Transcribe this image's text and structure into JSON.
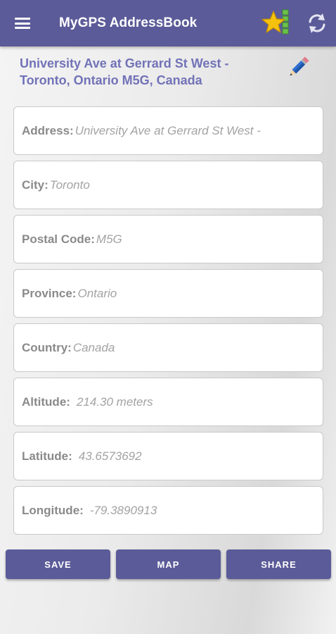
{
  "app_bar": {
    "title": "MyGPS AddressBook",
    "menu_icon": "hamburger-menu-icon",
    "favorites_icon": "star-list-icon",
    "refresh_icon": "refresh-icon",
    "background_color": "#5b5b99"
  },
  "header": {
    "address_title": "University Ave at Gerrard St West - Toronto, Ontario M5G, Canada",
    "edit_icon": "pencil-icon",
    "title_color": "#7272b8"
  },
  "fields": [
    {
      "label": "Address:",
      "value": "University Ave at Gerrard St West -"
    },
    {
      "label": "City:",
      "value": "Toronto"
    },
    {
      "label": "Postal Code:",
      "value": "M5G"
    },
    {
      "label": "Province:",
      "value": "Ontario"
    },
    {
      "label": "Country:",
      "value": "Canada"
    },
    {
      "label": "Altitude:",
      "value": "214.30 meters"
    },
    {
      "label": "Latitude:",
      "value": "43.6573692"
    },
    {
      "label": "Longitude:",
      "value": "-79.3890913"
    }
  ],
  "buttons": {
    "save": "SAVE",
    "map": "MAP",
    "share": "SHARE"
  }
}
